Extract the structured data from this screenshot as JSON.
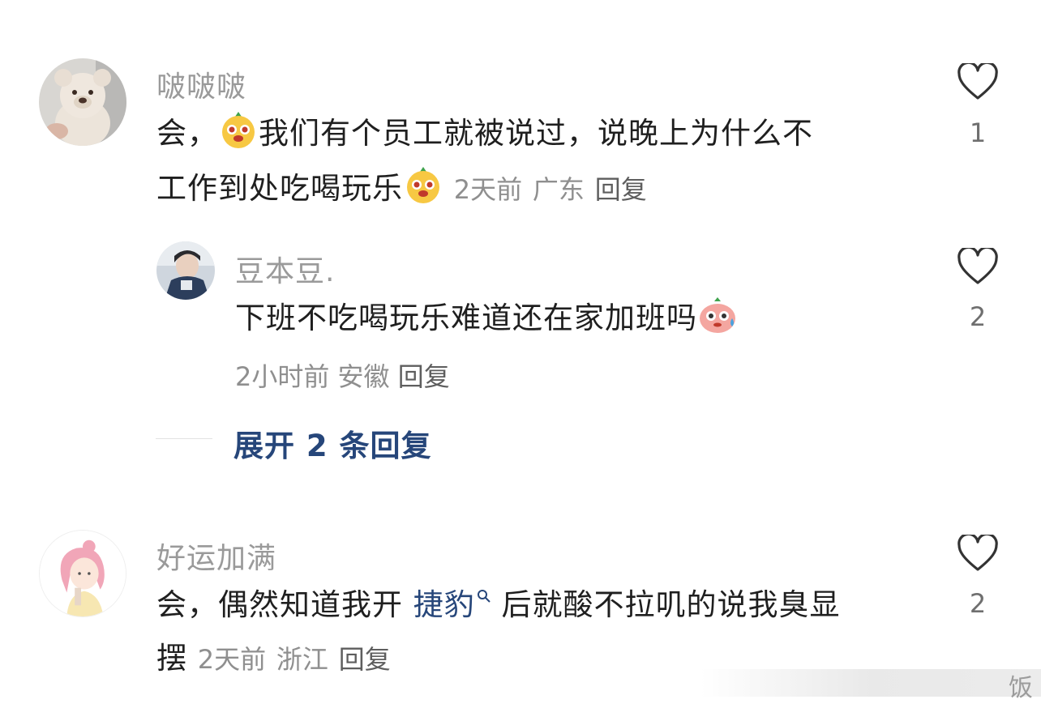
{
  "comments": [
    {
      "username": "啵啵啵",
      "line1_before": "会，",
      "line1_after": "我们有个员工就被说过，说晚上为什么不",
      "line2": "工作到处吃喝玩乐",
      "time": "2天前",
      "location": "广东",
      "reply_label": "回复",
      "like_count": "1",
      "emoji": "lemon-face-emoji"
    },
    {
      "username": "豆本豆.",
      "text": "下班不吃喝玩乐难道还在家加班吗",
      "time": "2小时前",
      "location": "安徽",
      "reply_label": "回复",
      "like_count": "2",
      "emoji": "sweating-face-emoji"
    },
    {
      "username": "好运加满",
      "line1_before": "会，偶然知道我开",
      "hashtag": "捷豹",
      "line1_after": "后就酸不拉叽的说我臭显",
      "line2": "摆",
      "time": "2天前",
      "location": "浙江",
      "reply_label": "回复",
      "like_count": "2"
    }
  ],
  "expand_replies": "展开 2 条回复",
  "watermark": "饭",
  "colors": {
    "username": "#9a9a9a",
    "body_text": "#1f1f1f",
    "link": "#26467a",
    "meta": "#8f8f8f"
  }
}
